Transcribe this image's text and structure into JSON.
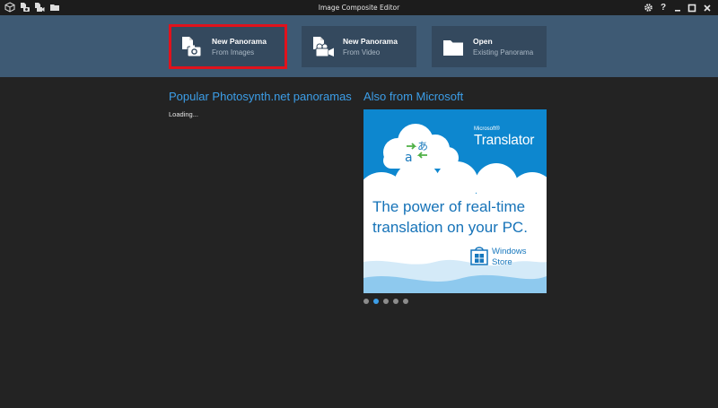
{
  "window": {
    "title": "Image Composite Editor",
    "toolbar_icons": [
      "cube-icon",
      "new-from-images-icon",
      "new-from-video-icon",
      "open-folder-icon"
    ],
    "controls": [
      "settings-icon",
      "help-icon",
      "minimize-icon",
      "maximize-icon",
      "close-icon"
    ],
    "help_label": "?"
  },
  "tiles": [
    {
      "title": "New Panorama",
      "subtitle": "From Images",
      "icon": "image-camera-icon",
      "selected": true
    },
    {
      "title": "New Panorama",
      "subtitle": "From Video",
      "icon": "video-camera-icon",
      "selected": false
    },
    {
      "title": "Open",
      "subtitle": "Existing Panorama",
      "icon": "folder-icon",
      "selected": false
    }
  ],
  "popular": {
    "title": "Popular Photosynth.net panoramas",
    "status": "Loading..."
  },
  "also": {
    "title": "Also from Microsoft",
    "ad": {
      "brand_small": "Microsoft®",
      "brand": "Translator",
      "headline_line1": "The power of real-time",
      "headline_line2": "translation on your PC.",
      "store_line1": "Windows",
      "store_line2": "Store"
    },
    "carousel": {
      "count": 5,
      "active_index": 1
    }
  },
  "colors": {
    "header_band": "#3e5a74",
    "tile": "#34495e",
    "selection": "#e0121c",
    "accent": "#3c9ee8",
    "ad_background": "#0d87cf"
  }
}
